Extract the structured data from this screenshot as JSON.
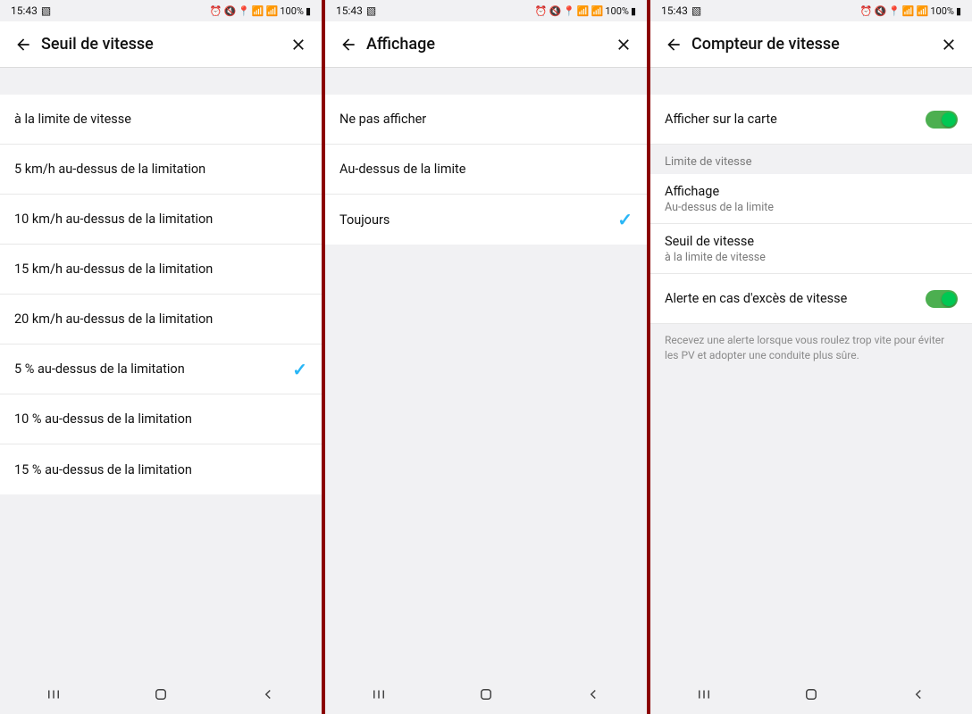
{
  "status": {
    "time": "15:43",
    "battery": "100%"
  },
  "panel1": {
    "title": "Seuil de vitesse",
    "options": [
      "à la limite de vitesse",
      "5 km/h au-dessus de la limitation",
      "10 km/h au-dessus de la limitation",
      "15 km/h au-dessus de la limitation",
      "20 km/h au-dessus de la limitation",
      "5 % au-dessus de la limitation",
      "10 % au-dessus de la limitation",
      "15 % au-dessus de la limitation"
    ],
    "selectedIndex": 5
  },
  "panel2": {
    "title": "Affichage",
    "options": [
      "Ne pas afficher",
      "Au-dessus de la limite",
      "Toujours"
    ],
    "selectedIndex": 2
  },
  "panel3": {
    "title": "Compteur de vitesse",
    "showOnMap": {
      "label": "Afficher sur la carte",
      "on": true
    },
    "sectionHeader": "Limite de vitesse",
    "affichage": {
      "label": "Affichage",
      "value": "Au-dessus de la limite"
    },
    "seuil": {
      "label": "Seuil de vitesse",
      "value": "à la limite de vitesse"
    },
    "alerte": {
      "label": "Alerte en cas d'excès de vitesse",
      "on": true
    },
    "note": "Recevez une alerte lorsque vous roulez trop vite pour éviter les PV et adopter une conduite plus sûre."
  }
}
